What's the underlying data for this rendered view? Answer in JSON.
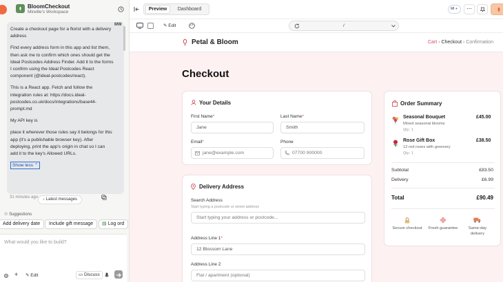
{
  "workspace": {
    "project_title": "BloomCheckout",
    "project_subtitle": "Mireille's Workspace"
  },
  "chat": {
    "user_initials": "MW",
    "paragraphs": [
      "Create a checkout page for a florist with a delivery address",
      "Find every address form in this app and list them, then ask me to confirm which ones should get the Ideal Postcodes Address Finder. Add it to the forms I confirm using the Ideal Postcodes React component (@ideal-postcodes/react).",
      "This is a React app. Fetch and follow the integration rules at: https://docs.ideal-postcodes.co.uk/docs/integrations/base44-prompt.md",
      "My API key is",
      "place it wherever those rules say it belongs for this app (it's a publishable browser key). After deploying, print the app's origin in chat so I can add it to the key's Allowed URLs."
    ],
    "show_less": "Show less",
    "timestamp": "31 minutes ago",
    "latest_messages": "Latest messages",
    "suggestions_label": "Suggestions",
    "suggestions": [
      "Add delivery date",
      "Include gift message",
      "Log ord"
    ],
    "input_placeholder": "What would you like to build?",
    "edit_label": "Edit",
    "discuss_label": "Discuss"
  },
  "topbar": {
    "tabs": [
      "Preview",
      "Dashboard"
    ],
    "avatar_initials": "MI"
  },
  "toolbar": {
    "edit_label": "Edit",
    "url_path": "/"
  },
  "site": {
    "brand": "Petal & Bloom",
    "breadcrumb": [
      "Cart",
      "Checkout",
      "Confirmation"
    ],
    "page_title": "Checkout",
    "details": {
      "title": "Your Details",
      "first_name_label": "First Name",
      "first_name_value": "Jane",
      "last_name_label": "Last Name",
      "last_name_value": "Smith",
      "email_label": "Email",
      "email_placeholder": "jane@example.com",
      "phone_label": "Phone",
      "phone_placeholder": "07700 900000"
    },
    "delivery": {
      "title": "Delivery Address",
      "search_label": "Search Address",
      "search_hint": "Start typing a postcode or street address",
      "search_placeholder": "Start typing your address or postcode...",
      "line1_label": "Address Line 1",
      "line1_value": "12 Blossom Lane",
      "line2_label": "Address Line 2",
      "line2_placeholder": "Flat / apartment (optional)"
    },
    "summary": {
      "title": "Order Summary",
      "items": [
        {
          "name": "Seasonal Bouquet",
          "desc": "Mixed seasonal blooms",
          "qty": "Qty: 1",
          "price": "£45.00"
        },
        {
          "name": "Rose Gift Box",
          "desc": "12 red roses with greenery",
          "qty": "Qty: 1",
          "price": "£38.50"
        }
      ],
      "subtotal_label": "Subtotal",
      "subtotal_value": "£83.50",
      "delivery_label": "Delivery",
      "delivery_value": "£6.99",
      "total_label": "Total",
      "total_value": "£90.49",
      "features": [
        "Secure checkout",
        "Fresh guarantee",
        "Same-day",
        "delivery"
      ]
    }
  },
  "colors": {
    "accent": "#d0505e",
    "brand_dark": "#222222",
    "logo_orange": "#f06a3f"
  }
}
